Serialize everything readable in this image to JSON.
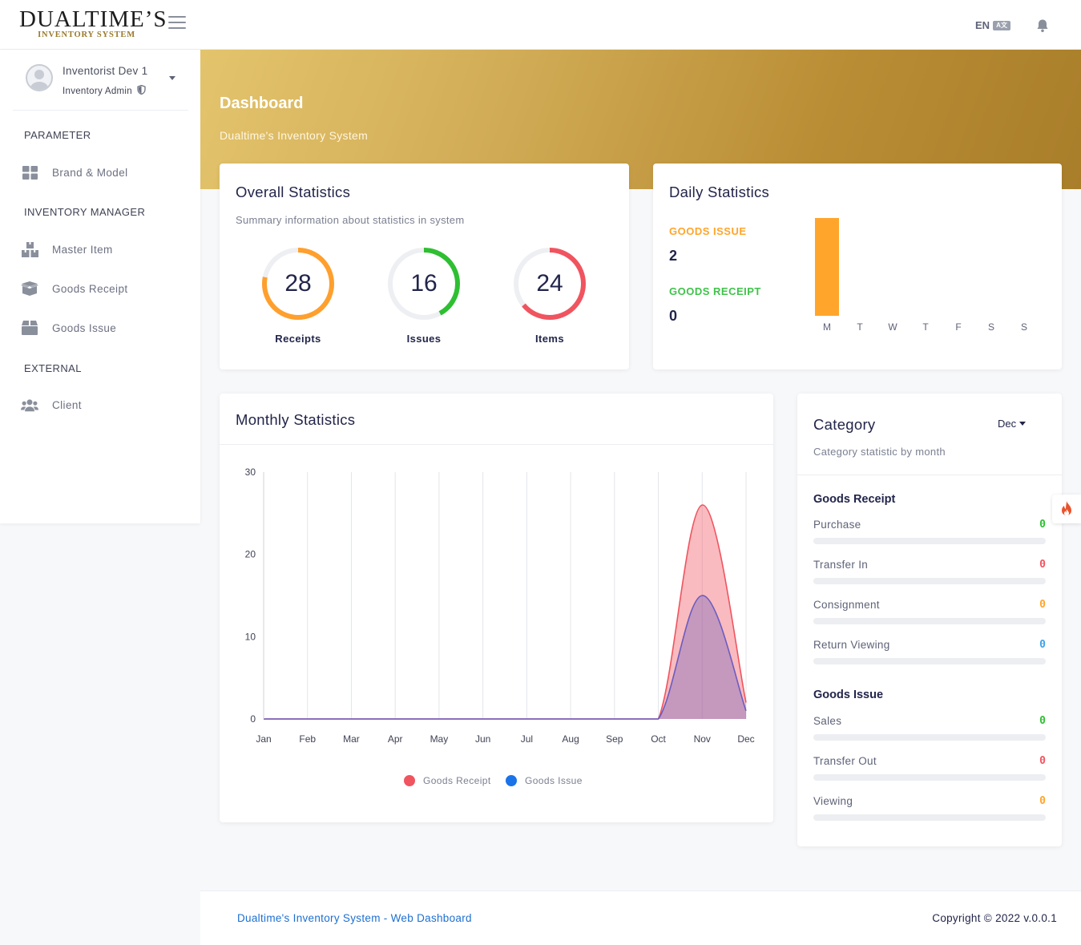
{
  "logo": {
    "line1": "DUALTIME’S",
    "line2": "INVENTORY SYSTEM"
  },
  "topbar": {
    "lang": "EN",
    "translate_icon_text": "A文"
  },
  "user": {
    "name": "Inventorist Dev 1",
    "role": "Inventory Admin"
  },
  "sidebar": {
    "sections": [
      {
        "title": "PARAMETER",
        "items": [
          {
            "label": "Brand & Model",
            "icon": "grid-icon"
          }
        ]
      },
      {
        "title": "INVENTORY MANAGER",
        "items": [
          {
            "label": "Master Item",
            "icon": "boxes-icon"
          },
          {
            "label": "Goods Receipt",
            "icon": "open-box-icon"
          },
          {
            "label": "Goods Issue",
            "icon": "box-icon"
          }
        ]
      },
      {
        "title": "EXTERNAL",
        "items": [
          {
            "label": "Client",
            "icon": "users-icon"
          }
        ]
      }
    ]
  },
  "hero": {
    "title": "Dashboard",
    "subtitle": "Dualtime's Inventory System"
  },
  "overall": {
    "title": "Overall Statistics",
    "subtitle": "Summary information about statistics in system",
    "stats": [
      {
        "value": "28",
        "label": "Receipts",
        "color": "#ff9f2d",
        "fraction": 0.78
      },
      {
        "value": "16",
        "label": "Issues",
        "color": "#2ebf32",
        "fraction": 0.42
      },
      {
        "value": "24",
        "label": "Items",
        "color": "#f0545f",
        "fraction": 0.64
      }
    ]
  },
  "daily": {
    "title": "Daily Statistics",
    "goods_issue_label": "GOODS ISSUE",
    "goods_issue_value": "2",
    "goods_receipt_label": "GOODS RECEIPT",
    "goods_receipt_value": "0",
    "issue_color": "#ffa52b",
    "receipt_color": "#3fc34a",
    "chart_data": {
      "type": "bar",
      "categories": [
        "M",
        "T",
        "W",
        "T",
        "F",
        "S",
        "S"
      ],
      "values": [
        2,
        0,
        0,
        0,
        0,
        0,
        0
      ],
      "ylim": [
        0,
        2
      ]
    }
  },
  "monthly": {
    "title": "Monthly Statistics",
    "chart_data": {
      "type": "area",
      "categories": [
        "Jan",
        "Feb",
        "Mar",
        "Apr",
        "May",
        "Jun",
        "Jul",
        "Aug",
        "Sep",
        "Oct",
        "Nov",
        "Dec"
      ],
      "series": [
        {
          "name": "Goods Receipt",
          "color": "#f0545f",
          "values": [
            0,
            0,
            0,
            0,
            0,
            0,
            0,
            0,
            0,
            0,
            26,
            2
          ]
        },
        {
          "name": "Goods Issue",
          "color": "#1a73e8",
          "values": [
            0,
            0,
            0,
            0,
            0,
            0,
            0,
            0,
            0,
            0,
            15,
            1
          ]
        }
      ],
      "yticks": [
        "30",
        "20",
        "10",
        "0"
      ],
      "ylim": [
        0,
        30
      ],
      "grid": true,
      "legend": "bottom"
    }
  },
  "category": {
    "title": "Category",
    "subtitle": "Category statistic by month",
    "month": "Dec",
    "groups": [
      {
        "title": "Goods Receipt",
        "rows": [
          {
            "name": "Purchase",
            "value": "0",
            "color": "#2ebf32"
          },
          {
            "name": "Transfer In",
            "value": "0",
            "color": "#f0545f"
          },
          {
            "name": "Consignment",
            "value": "0",
            "color": "#ffa52b"
          },
          {
            "name": "Return Viewing",
            "value": "0",
            "color": "#3ea2e8"
          }
        ]
      },
      {
        "title": "Goods Issue",
        "rows": [
          {
            "name": "Sales",
            "value": "0",
            "color": "#2ebf32"
          },
          {
            "name": "Transfer Out",
            "value": "0",
            "color": "#f0545f"
          },
          {
            "name": "Viewing",
            "value": "0",
            "color": "#ffa52b"
          }
        ]
      }
    ]
  },
  "footer": {
    "left": "Dualtime's Inventory System - Web Dashboard",
    "right": "Copyright © 2022 v.0.0.1"
  }
}
